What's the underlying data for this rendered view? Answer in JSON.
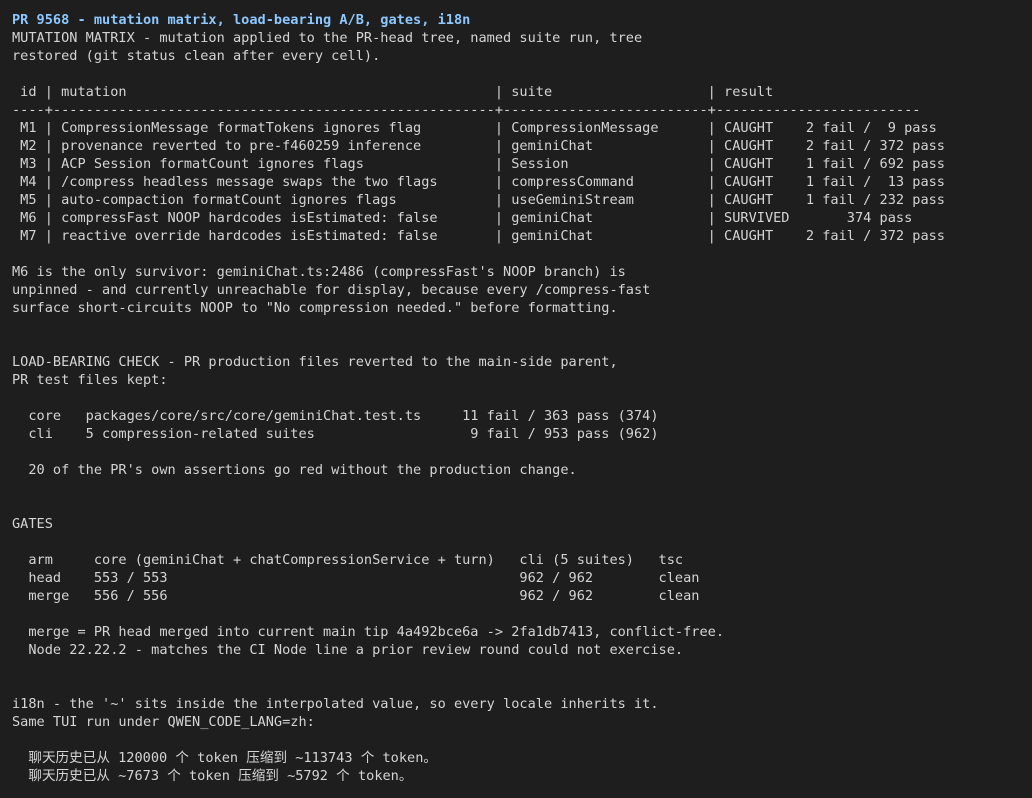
{
  "terminal": {
    "title_line": "PR 9568 - mutation matrix, load-bearing A/B, gates, i18n",
    "lines": [
      "MUTATION MATRIX - mutation applied to the PR-head tree, named suite run, tree",
      "restored (git status clean after every cell).",
      "",
      " id | mutation                                             | suite                   | result",
      "----+------------------------------------------------------+-------------------------+-------------------------",
      " M1 | CompressionMessage formatTokens ignores flag         | CompressionMessage      | CAUGHT    2 fail /  9 pass",
      " M2 | provenance reverted to pre-f460259 inference         | geminiChat              | CAUGHT    2 fail / 372 pass",
      " M3 | ACP Session formatCount ignores flags                | Session                 | CAUGHT    1 fail / 692 pass",
      " M4 | /compress headless message swaps the two flags       | compressCommand         | CAUGHT    1 fail /  13 pass",
      " M5 | auto-compaction formatCount ignores flags            | useGeminiStream         | CAUGHT    1 fail / 232 pass",
      " M6 | compressFast NOOP hardcodes isEstimated: false       | geminiChat              | SURVIVED       374 pass",
      " M7 | reactive override hardcodes isEstimated: false       | geminiChat              | CAUGHT    2 fail / 372 pass",
      "",
      "M6 is the only survivor: geminiChat.ts:2486 (compressFast's NOOP branch) is",
      "unpinned - and currently unreachable for display, because every /compress-fast",
      "surface short-circuits NOOP to \"No compression needed.\" before formatting.",
      "",
      "",
      "LOAD-BEARING CHECK - PR production files reverted to the main-side parent,",
      "PR test files kept:",
      "",
      "  core   packages/core/src/core/geminiChat.test.ts     11 fail / 363 pass (374)",
      "  cli    5 compression-related suites                   9 fail / 953 pass (962)",
      "",
      "  20 of the PR's own assertions go red without the production change.",
      "",
      "",
      "GATES",
      "",
      "  arm     core (geminiChat + chatCompressionService + turn)   cli (5 suites)   tsc",
      "  head    553 / 553                                           962 / 962        clean",
      "  merge   556 / 556                                           962 / 962        clean",
      "",
      "  merge = PR head merged into current main tip 4a492bce6a -> 2fa1db7413, conflict-free.",
      "  Node 22.22.2 - matches the CI Node line a prior review round could not exercise.",
      "",
      "",
      "i18n - the '~' sits inside the interpolated value, so every locale inherits it.",
      "Same TUI run under QWEN_CODE_LANG=zh:",
      "",
      "  聊天历史已从 120000 个 token 压缩到 ~113743 个 token。",
      "  聊天历史已从 ~7673 个 token 压缩到 ~5792 个 token。"
    ]
  }
}
